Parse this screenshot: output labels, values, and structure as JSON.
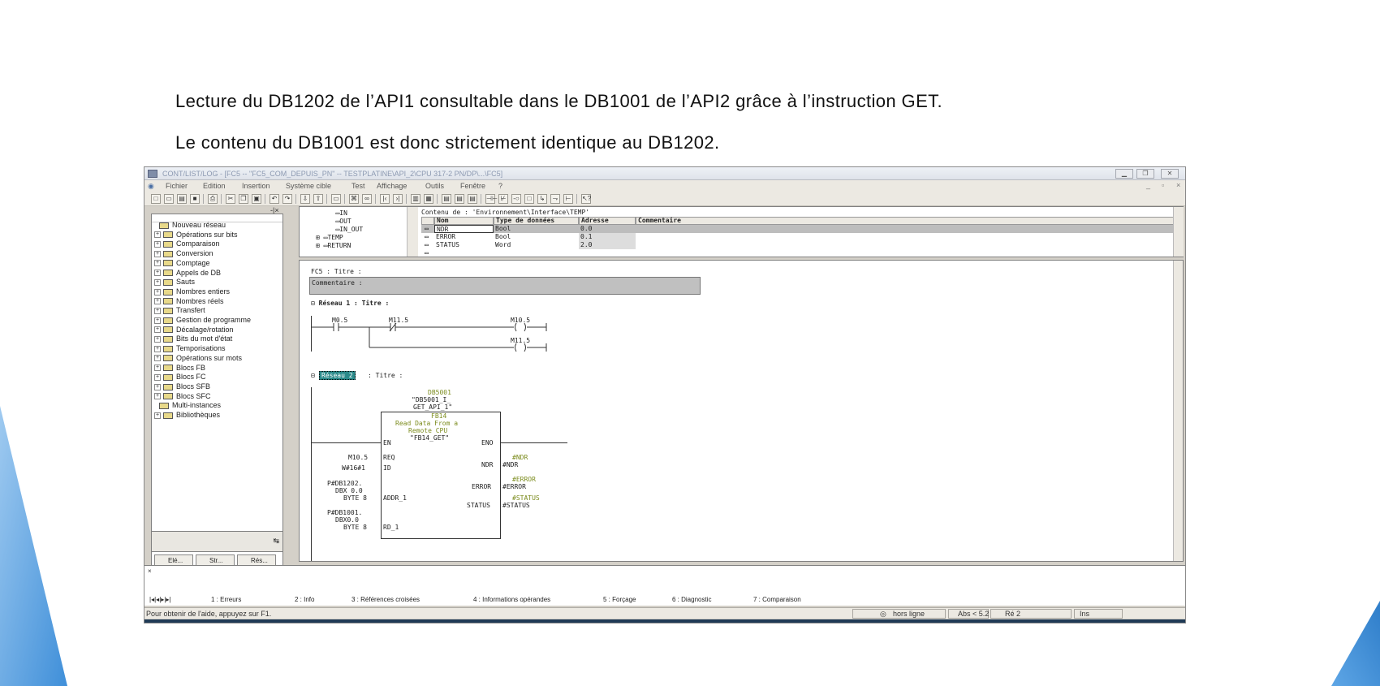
{
  "captions": {
    "line1": "Lecture du DB1202 de l’API1 consultable dans le DB1001 de l’API2 grâce à l’instruction GET.",
    "line2": "Le contenu du DB1001 est donc strictement identique au DB1202."
  },
  "window": {
    "title": "CONT/LIST/LOG - [FC5 -- \"FC5_COM_DEPUIS_PN\" -- TESTPLATINE\\API_2\\CPU 317-2 PN/DP\\...\\FC5]"
  },
  "menu": [
    "Fichier",
    "Edition",
    "Insertion",
    "Système cible",
    "Test",
    "Affichage",
    "Outils",
    "Fenêtre",
    "?"
  ],
  "catalog": {
    "items": [
      "Nouveau réseau",
      "Opérations sur bits",
      "Comparaison",
      "Conversion",
      "Comptage",
      "Appels de DB",
      "Sauts",
      "Nombres entiers",
      "Nombres réels",
      "Transfert",
      "Gestion de programme",
      "Décalage/rotation",
      "Bits du mot d'état",
      "Temporisations",
      "Opérations sur mots",
      "Blocs FB",
      "Blocs FC",
      "Blocs SFB",
      "Blocs SFC",
      "Multi-instances",
      "Bibliothèques"
    ],
    "tabs": [
      "Elé...",
      "Str...",
      "Rés..."
    ]
  },
  "interface": {
    "tree": [
      "IN",
      "OUT",
      "IN_OUT",
      "TEMP",
      "RETURN"
    ],
    "content_label": "Contenu de : 'Environnement\\Interface\\TEMP'",
    "columns": [
      "Nom",
      "Type de données",
      "Adresse",
      "Commentaire"
    ],
    "rows": [
      {
        "name": "NDR",
        "type": "Bool",
        "addr": "0.0"
      },
      {
        "name": "ERROR",
        "type": "Bool",
        "addr": "0.1"
      },
      {
        "name": "STATUS",
        "type": "Word",
        "addr": "2.0"
      }
    ]
  },
  "code": {
    "block_title": "FC5 : Titre :",
    "comment": "Commentaire :",
    "net1_title": "Réseau 1 : Titre :",
    "net1_c1": "M0.5",
    "net1_c2": "M11.5",
    "net1_coil1": "M10.5",
    "net1_coil2": "M11.5",
    "net2_label": "Réseau 2",
    "net2_title": ": Titre :",
    "instance": "DB5001",
    "instance_name1": "\"DB5001_I_",
    "instance_name2": "GET_API_1\"",
    "fb": "FB14",
    "fb_desc1": "Read Data From a",
    "fb_desc2": "Remote CPU",
    "fb_name": "\"FB14_GET\"",
    "pin_en": "EN",
    "pin_eno": "ENO",
    "pin_req": "REQ",
    "pin_id": "ID",
    "pin_addr": "ADDR_1",
    "pin_rd": "RD_1",
    "pin_ndr": "NDR",
    "pin_error": "ERROR",
    "pin_status": "STATUS",
    "in_req": "M10.5",
    "in_id": "W#16#1",
    "in_addr1": "P#DB1202.",
    "in_addr2": "DBX 0.0",
    "in_addr3": "BYTE 8",
    "in_rd1": "P#DB1001.",
    "in_rd2": "DBX0.0",
    "in_rd3": "BYTE 8",
    "out_ndr_tag": "#NDR",
    "out_ndr": "#NDR",
    "out_error_tag": "#ERROR",
    "out_error": "#ERROR",
    "out_status_tag": "#STATUS",
    "out_status": "#STATUS"
  },
  "bottom_tabs": [
    "1 : Erreurs",
    "2 : Info",
    "3 : Références croisées",
    "4 : Informations opérandes",
    "5 : Forçage",
    "6 : Diagnostic",
    "7 : Comparaison"
  ],
  "status": {
    "help": "Pour obtenir de l'aide, appuyez sur F1.",
    "online": "hors ligne",
    "abs": "Abs < 5.2",
    "re": "Ré 2",
    "ins": "Ins"
  },
  "colors": {
    "accent_blue": "#3f8fd9",
    "window_bg": "#d4d0c8",
    "highlight_teal": "#2b8a8a",
    "symbol_green": "#7b8b1c"
  }
}
